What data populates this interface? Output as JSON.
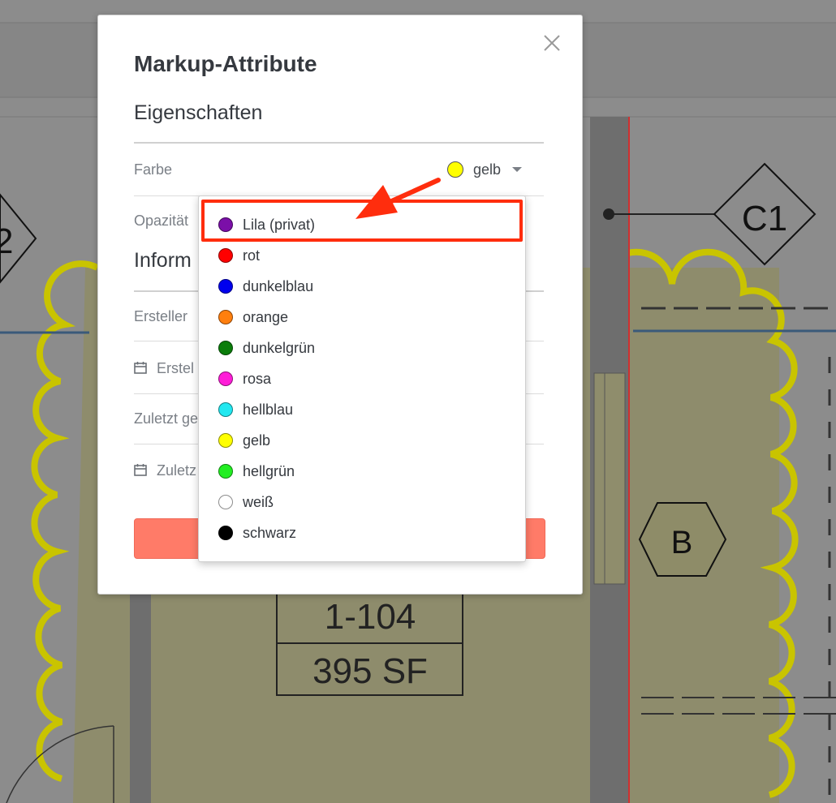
{
  "modal": {
    "title": "Markup-Attribute",
    "section_properties": "Eigenschaften",
    "section_info": "Inform",
    "labels": {
      "color": "Farbe",
      "opacity": "Opazität",
      "creator": "Ersteller",
      "created": "Erstel",
      "last_modified_by": "Zuletzt ge",
      "last_modified": "Zuletz"
    },
    "color_select": {
      "value": "gelb",
      "swatch": "#ffff00"
    }
  },
  "dropdown": {
    "options": [
      {
        "label": "Lila (privat)",
        "color": "#7b0fa8"
      },
      {
        "label": "rot",
        "color": "#ff0000"
      },
      {
        "label": "dunkelblau",
        "color": "#0000ee"
      },
      {
        "label": "orange",
        "color": "#ff7f0e"
      },
      {
        "label": "dunkelgrün",
        "color": "#0a7d0a"
      },
      {
        "label": "rosa",
        "color": "#ff1dd8"
      },
      {
        "label": "hellblau",
        "color": "#22e8f0"
      },
      {
        "label": "gelb",
        "color": "#ffff00"
      },
      {
        "label": "hellgrün",
        "color": "#22ee22"
      },
      {
        "label": "weiß",
        "color": "#ffffff"
      },
      {
        "label": "schwarz",
        "color": "#000000"
      }
    ]
  },
  "background": {
    "tags": {
      "c1": "C1",
      "b": "B",
      "two": "2"
    },
    "room": {
      "number": "1-104",
      "area": "395 SF"
    }
  },
  "colors": {
    "accent_red": "#ff2d0d",
    "button_red": "#ff7b68",
    "cloud": "#c9c400"
  }
}
